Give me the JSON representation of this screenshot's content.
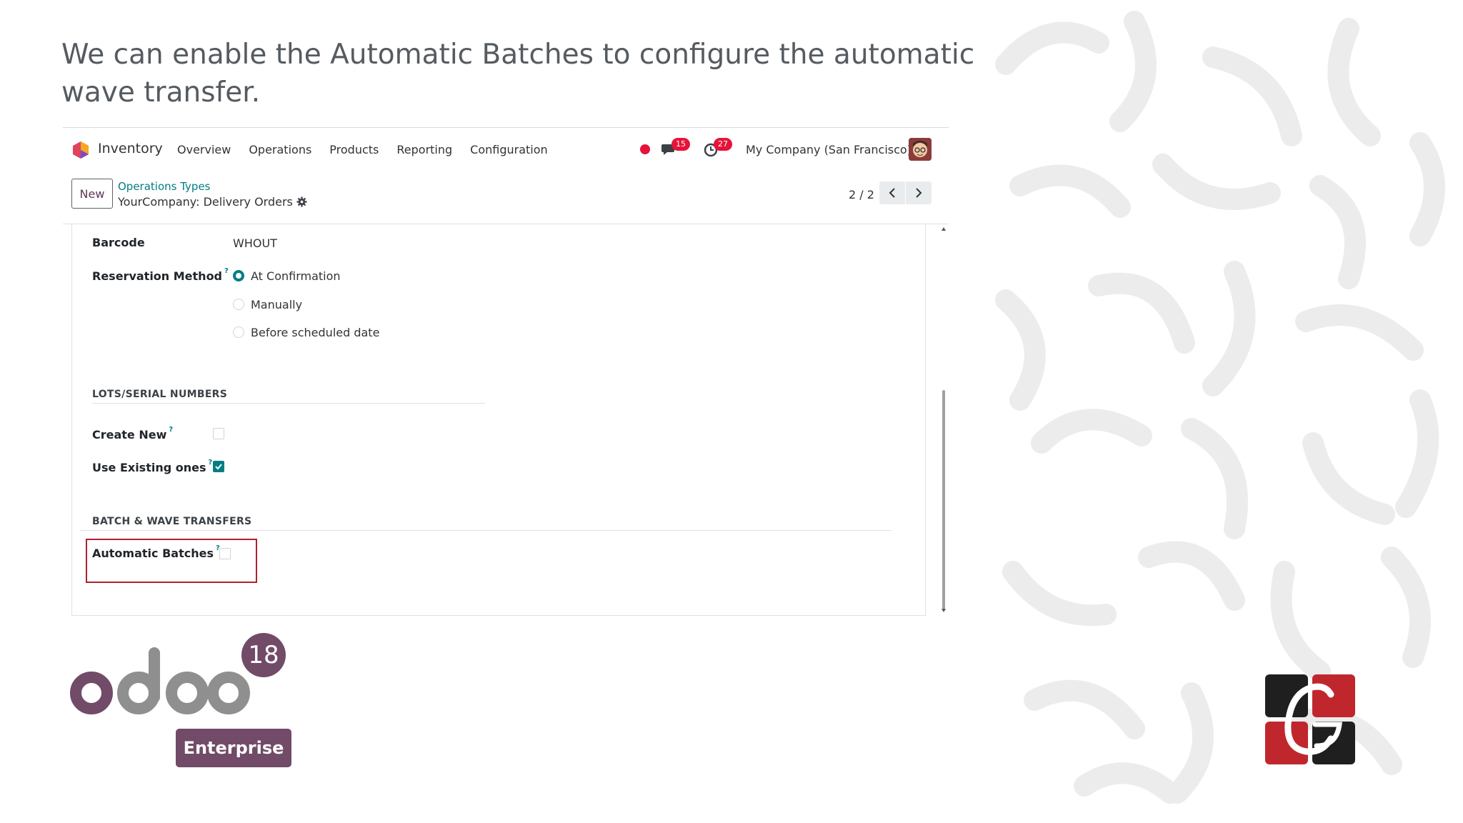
{
  "slide": {
    "title": "We can enable the Automatic Batches to configure the automatic wave transfer."
  },
  "navbar": {
    "app_name": "Inventory",
    "menu": [
      "Overview",
      "Operations",
      "Products",
      "Reporting",
      "Configuration"
    ],
    "chat_badge": "15",
    "activity_badge": "27",
    "company": "My Company (San Francisco)"
  },
  "control_panel": {
    "new_label": "New",
    "breadcrumb_parent": "Operations Types",
    "breadcrumb_current": "YourCompany: Delivery Orders",
    "pager": "2 / 2"
  },
  "form": {
    "barcode_label": "Barcode",
    "barcode_value": "WHOUT",
    "reservation_label": "Reservation Method",
    "reservation_options": [
      "At Confirmation",
      "Manually",
      "Before scheduled date"
    ],
    "reservation_selected": "At Confirmation",
    "lots_section": "LOTS/SERIAL NUMBERS",
    "create_new_label": "Create New",
    "create_new_checked": false,
    "use_existing_label": "Use Existing ones",
    "use_existing_checked": true,
    "batch_section": "BATCH & WAVE TRANSFERS",
    "automatic_batches_label": "Automatic Batches",
    "automatic_batches_checked": false,
    "help_mark": "?"
  },
  "branding": {
    "version": "18",
    "edition": "Enterprise"
  },
  "colors": {
    "accent": "#017e84",
    "brand": "#714b67",
    "badge": "#e5133a",
    "highlight": "#b02030"
  }
}
